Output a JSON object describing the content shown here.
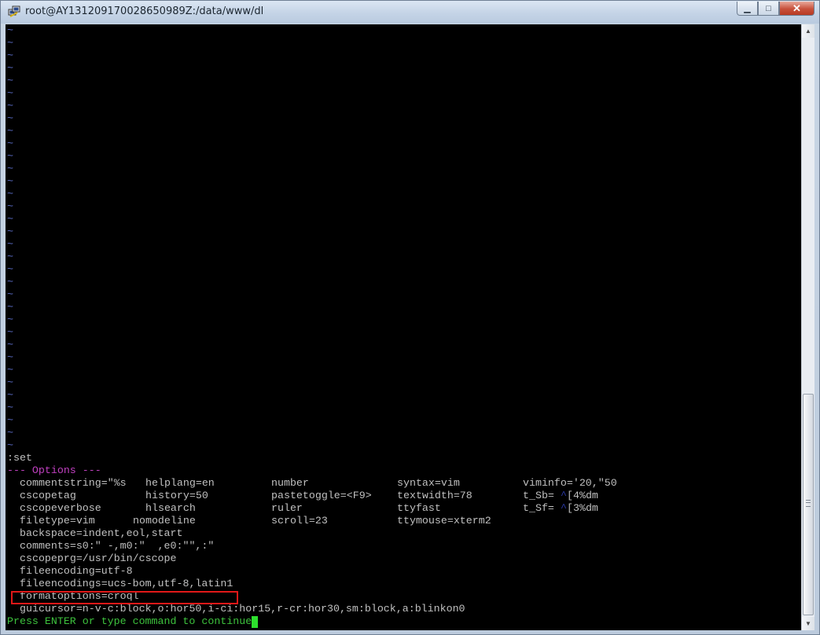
{
  "window": {
    "title": "root@AY131209170028650989Z:/data/www/dl",
    "minimize_glyph": "▁",
    "maximize_glyph": "□",
    "close_glyph": "✕",
    "app_icon": "putty-icon"
  },
  "terminal": {
    "tilde": "~",
    "command": ":set",
    "options_header": "--- Options ---",
    "grid_rows": [
      [
        "commentstring=\"%s",
        "helplang=en",
        "number",
        "syntax=vim",
        "viminfo='20,\"50"
      ],
      [
        "cscopetag",
        "history=50",
        "pastetoggle=<F9>",
        "textwidth=78",
        "t_Sb=",
        "[4%dm"
      ],
      [
        "cscopeverbose",
        "hlsearch",
        "ruler",
        "ttyfast",
        "t_Sf=",
        "[3%dm"
      ],
      [
        "filetype=vim",
        "nomodeline",
        "scroll=23",
        "ttymouse=xterm2"
      ]
    ],
    "escape_glyph": "^",
    "long_lines": [
      "backspace=indent,eol,start",
      "comments=s0:\" -,m0:\"  ,e0:\"\",:\"",
      "cscopeprg=/usr/bin/cscope",
      "fileencoding=utf-8",
      "fileencodings=ucs-bom,utf-8,latin1",
      "formatoptions=croql",
      "guicursor=n-v-c:block,o:hor50,i-ci:hor15,r-cr:hor30,sm:block,a:blinkon0"
    ],
    "prompt": "Press ENTER or type command to continue"
  },
  "colors": {
    "tilde": "#5b6dc8",
    "header": "#c040c0",
    "prompt": "#3dc23d",
    "highlight_box": "#e01818"
  }
}
